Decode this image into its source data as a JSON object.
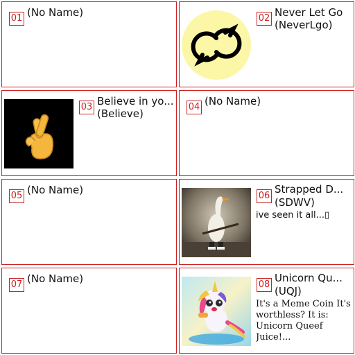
{
  "tokens": [
    {
      "index": "01",
      "title": "(No Name)"
    },
    {
      "index": "02",
      "title": "Never Let Go",
      "ticker": "(NeverLgo)",
      "image": "interlocked-rings-logo"
    },
    {
      "index": "03",
      "title": "Believe in yo...",
      "ticker": "(Believe)",
      "image": "crossed-fingers-emoji"
    },
    {
      "index": "04",
      "title": "(No Name)"
    },
    {
      "index": "05",
      "title": "(No Name)"
    },
    {
      "index": "06",
      "title": "Strapped D...",
      "ticker": "(SDWV)",
      "description": "ive seen it all...▯",
      "image": "goose-with-rifle-photo"
    },
    {
      "index": "07",
      "title": "(No Name)"
    },
    {
      "index": "08",
      "title": "Unicorn Qu...",
      "ticker": "(UQJ)",
      "description": "It's a Meme Coin It's worthless? It is: Unicorn Queef Juice!...",
      "image": "cartoon-unicorn-splash"
    }
  ],
  "colors": {
    "border": "#cc2222",
    "badge_text": "#cc2222",
    "logo_bg": "#fbf7a6"
  }
}
